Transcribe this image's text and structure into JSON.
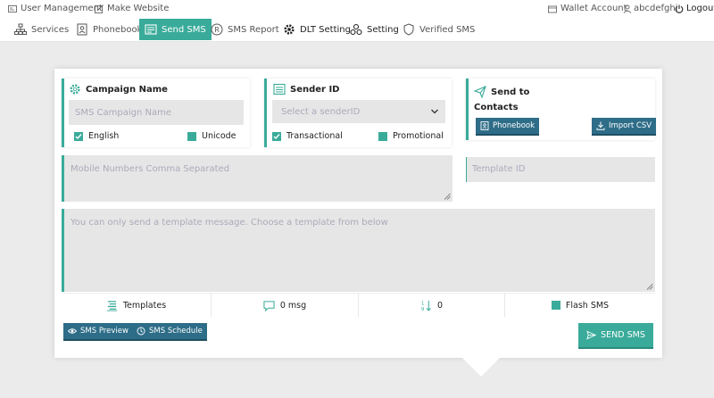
{
  "topbar": {
    "user_management": "User Management",
    "make_website": "Make Website",
    "wallet_account": "Wallet Account",
    "username": "abcdefghi",
    "logout": "Logout"
  },
  "nav": {
    "services": "Services",
    "phonebook": "Phonebook",
    "send_sms": "Send SMS",
    "sms_report": "SMS Report",
    "dlt_setting": "DLT Setting",
    "setting": "Setting",
    "verified_sms": "Verified SMS"
  },
  "campaign": {
    "title": "Campaign Name",
    "placeholder": "SMS Campaign Name",
    "english": "English",
    "unicode": "Unicode"
  },
  "sender": {
    "title": "Sender ID",
    "placeholder": "Select a senderID",
    "transactional": "Transactional",
    "promotional": "Promotional"
  },
  "sendto": {
    "title": "Send to",
    "contacts": "Contacts",
    "phonebook_btn": "Phonebook",
    "import_btn": "Import CSV"
  },
  "mobile": {
    "placeholder": "Mobile Numbers Comma Separated"
  },
  "template_id": {
    "placeholder": "Template ID"
  },
  "message": {
    "placeholder": "You can only send a template message. Choose a template from below"
  },
  "toolbar": {
    "templates": "Templates",
    "msg_count": "0 msg",
    "char_count": "0",
    "flash_sms": "Flash SMS"
  },
  "actions": {
    "preview": "SMS Preview",
    "schedule": "SMS Schedule",
    "send": "SEND SMS"
  },
  "colors": {
    "accent": "#3aab9a",
    "dark_button": "#2e6d88"
  }
}
